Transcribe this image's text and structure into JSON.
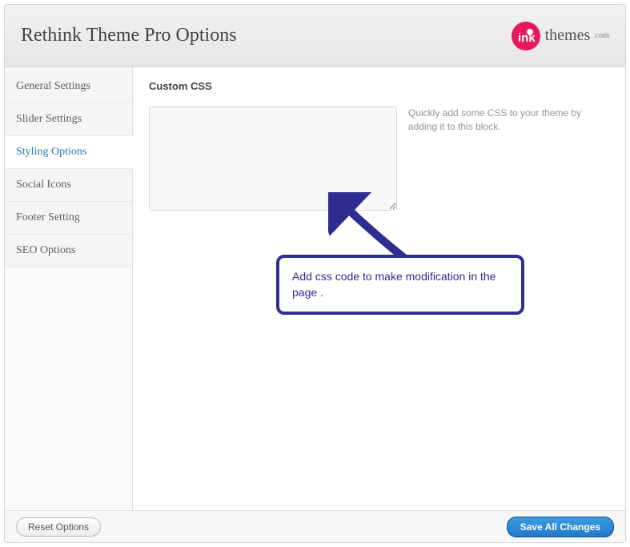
{
  "header": {
    "title": "Rethink Theme Pro Options",
    "logo_text": "themes",
    "logo_suffix": ".com"
  },
  "sidebar": {
    "items": [
      {
        "label": "General Settings"
      },
      {
        "label": "Slider Settings"
      },
      {
        "label": "Styling Options"
      },
      {
        "label": "Social Icons"
      },
      {
        "label": "Footer Setting"
      },
      {
        "label": "SEO Options"
      }
    ],
    "active_index": 2
  },
  "content": {
    "section_title": "Custom CSS",
    "helper_text": "Quickly add some CSS to your theme by adding it to this block.",
    "textarea_value": ""
  },
  "footer": {
    "reset_label": "Reset Options",
    "save_label": "Save All Changes"
  },
  "annotation": {
    "callout_text": "Add css code to make modification in the page ."
  },
  "colors": {
    "accent": "#2a7aa8",
    "annotation": "#2d2e8f",
    "save_button": "#227ac6"
  }
}
